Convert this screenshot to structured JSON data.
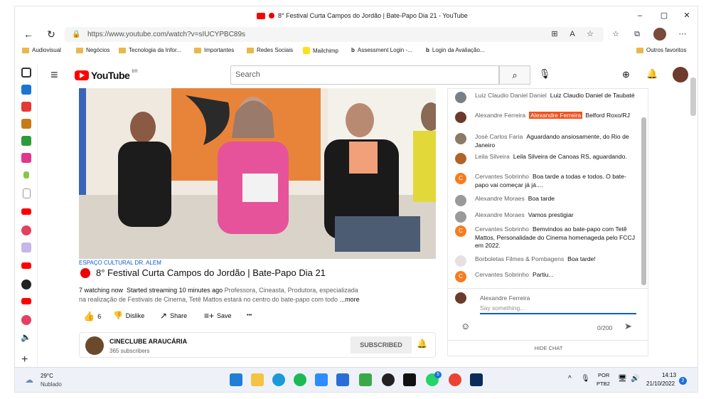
{
  "window": {
    "title": "8° Festival Curta Campos do Jordão | Bate-Papo Dia 21 - YouTube",
    "minimize": "–",
    "maximize": "▢",
    "close": "✕"
  },
  "address_bar": {
    "url": "https://www.youtube.com/watch?v=sIUCYPBC89s"
  },
  "bookmarks": [
    "Audiovisual",
    "Negócios",
    "Tecnologia da Infor...",
    "Importantes",
    "Redes Sociais",
    "Mailchimp",
    "Assessment Login -...",
    "Login da Avaliação...",
    "Outros favoritos"
  ],
  "youtube": {
    "logo": "YouTube",
    "region": "BR",
    "search_placeholder": "Search"
  },
  "video": {
    "channel_location": "ESPAÇO CULTURAL DR. ALEM",
    "title": "8° Festival Curta Campos do Jordão | Bate-Papo Dia 21",
    "stats": "7 watching now  Started streaming 10 minutes ago",
    "description_1": "Professora, Cineasta, Produtora, especializada",
    "description_2": "na realização de Festivais de Cinema, Tetê Mattos estará no centro do bate-papo com todo",
    "more": "...more",
    "likes": "6",
    "dislike": "Dislike",
    "share": "Share",
    "save": "Save",
    "more_actions": "•••",
    "channel": "CINECLUBE ARAUCÁRIA",
    "subscribers": "365 subscribers",
    "subscribed": "SUBSCRIBED"
  },
  "chat": {
    "messages": [
      {
        "author": "Luiz Claudio Daniel Daniel",
        "text": "Luiz Claudio Daniel de Taubaté",
        "avatar_color": "#7a8088"
      },
      {
        "author": "Alexandre Ferreira",
        "mention": "Alexandre Ferreira",
        "text": "Belford Roxo/RJ",
        "avatar_color": "#6b3a2a"
      },
      {
        "author": "José Carlos Faria",
        "text": "Aguardando ansiosamente, do Rio de Janeiro",
        "avatar_color": "#8c7a66"
      },
      {
        "author": "Leila Silveira",
        "text": "Leila Silveira de Canoas RS, aguardando.",
        "avatar_color": "#b0642a"
      },
      {
        "author": "Cervantes Sobrinho",
        "text": "Boa tarde a todas e todos. O bate-papo vai começar já já....",
        "avatar_color": "#f57c1f",
        "initial": "C"
      },
      {
        "author": "Alexandre Moraes",
        "text": "Boa tarde",
        "avatar_color": "#9a9a9a"
      },
      {
        "author": "Alexandre Moraes",
        "text": "Vamos prestigiar",
        "avatar_color": "#9a9a9a"
      },
      {
        "author": "Cervantes Sobrinho",
        "text": "Bemvindos ao bate-papo com Tetê Mattos, Personalidade do Cinema homenageda pelo FCCJ em 2022.",
        "avatar_color": "#f57c1f",
        "initial": "C"
      },
      {
        "author": "Borboletas Filmes & Pombagens",
        "text": "Boa tarde!",
        "avatar_color": "#e8e0e0"
      },
      {
        "author": "Cervantes Sobrinho",
        "text": "Partiu...",
        "avatar_color": "#f57c1f",
        "initial": "C"
      }
    ],
    "input_author": "Alexandre Ferreira",
    "input_placeholder": "Say something...",
    "counter": "0/200",
    "hide_chat": "HIDE CHAT"
  },
  "taskbar": {
    "temp": "29°C",
    "weather": "Nublado",
    "lang1": "POR",
    "lang2": "PTB2",
    "time": "14:13",
    "date": "21/10/2022",
    "notif": "2",
    "whatsapp_badge": "5"
  }
}
